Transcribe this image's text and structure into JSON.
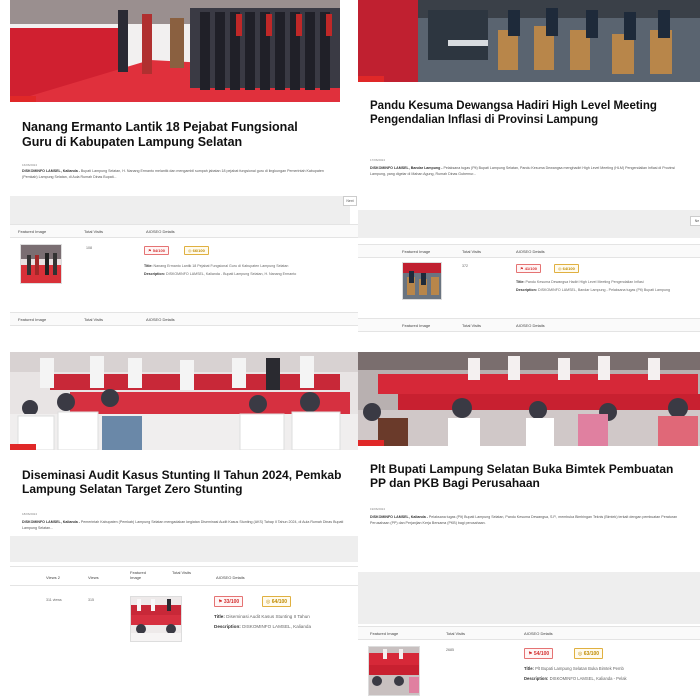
{
  "posts": [
    {
      "title": "Nanang Ermanto Lantik 18 Pejabat Fungsional Guru di Kabupaten Lampung Selatan",
      "meta": "16/06/2024",
      "excerpt_strong": "DISKOMINFO LAMSEL, Kalianda -",
      "excerpt": "Bupati Lampung Selatan, H. Nanang Ermanto melantik dan mengambil sumpah jabatan 18 pejabat fungsional guru di lingkungan Pemerintah Kabupaten (Pemkab) Lampung Selatan, di Aula Rumah Dinas Bupati...",
      "table_headers": [
        "Featured Image",
        "Total Visits",
        "AIOSEO Details"
      ],
      "visits": "108",
      "badge_red": "54/100",
      "badge_yellow": "66/100",
      "title_label": "Title:",
      "seo_title": "Nanang Ermanto Lantik 18 Pejabat Fungsional Guru di Kabupaten Lampung Selatan",
      "desc_label": "Description:",
      "seo_desc": "DISKOMINFO LAMSEL, Kalianda - Bupati Lampung Selatan, H. Nanang Ermanto",
      "edge_button": "Next",
      "next_headers": [
        "Featured Image",
        "Total Visits",
        "AIOSEO Details"
      ]
    },
    {
      "title": "Pandu Kesuma Dewangsa Hadiri High Level Meeting Pengendalian Inflasi di Provinsi Lampung",
      "meta": "17/06/2024",
      "excerpt_strong": "DISKOMINFO LAMSEL, Bandar Lampung -",
      "excerpt": "Pelaksana tugas (Plt) Bupati Lampung Selatan, Pandu Kesuma Dewangsa menghadiri High Level Meeting (HLM) Pengendalian Inflasi di Provinsi Lampung, yang digelar di Mahan Agung, Rumah Dinas Gubernur...",
      "table_headers": [
        "Featured Image",
        "Total Visits",
        "AIOSEO Details"
      ],
      "visits": "372",
      "badge_red": "41/100",
      "badge_yellow": "64/100",
      "title_label": "Title:",
      "seo_title": "Pandu Kesuma Dewangsa Hadiri High Level Meeting Pengendalian Inflasi",
      "desc_label": "Description:",
      "seo_desc": "DISKOMINFO LAMSEL, Bandar Lampung - Pelaksana tugas (Plt) Bupati Lampung",
      "edge_button": "Ne",
      "next_headers": [
        "Featured Image",
        "Total Visits",
        "AIOSEO Details"
      ]
    },
    {
      "title": "Diseminasi Audit Kasus Stunting II Tahun 2024, Pemkab Lampung Selatan Target Zero Stunting",
      "meta": "18/06/2024",
      "excerpt_strong": "DISKOMINFO LAMSEL, Kalianda -",
      "excerpt": "Pemerintah Kabupaten (Pemkab) Lampung Selatan mengadakan kegiatan Diseminasi Audit Kasus Stunting (AKS) Tahap II Tahun 2024, di Aula Rumah Dinas Bupati Lampung Selatan...",
      "table_headers": [
        "Views 2",
        "Views",
        "Featured Image",
        "Total Visits",
        "AIOSEO Details"
      ],
      "views2": "311 views",
      "views": "315",
      "badge_red": "33/100",
      "badge_yellow": "64/100",
      "title_label": "Title:",
      "seo_title": "Diseminasi Audit Kasus Stunting II Tahun",
      "desc_label": "Description:",
      "seo_desc": "DISKOMINFO LAMSEL, Kalianda"
    },
    {
      "title": "Plt Bupati Lampung Selatan Buka Bimtek Pembuatan PP dan PKB Bagi Perusahaan",
      "meta": "19/06/2024",
      "excerpt_strong": "DISKOMINFO LAMSEL, Kalianda -",
      "excerpt": "Pelaksana tugas (Plt) Bupati Lampung Selatan, Pandu Kesuma Dewangsa, S.P., membuka Bimbingan Teknis (Bimtek) terkait dengan pembuatan Peraturan Perusahaan (PP) dan Perjanjian Kerja Bersama (PKB) bagi perusahaan.",
      "table_headers": [
        "Featured Image",
        "Total Visits",
        "AIOSEO Details"
      ],
      "visits": "2685",
      "badge_red": "54/100",
      "badge_yellow": "63/100",
      "title_label": "Title:",
      "seo_title": "Plt Bupati Lampung Selatan Buka Bimtek Pemb",
      "desc_label": "Description:",
      "seo_desc": "DISKOMINFO LAMSEL, Kalianda - Pelak"
    }
  ],
  "colors": {
    "accent_red": "#e02828",
    "badge_red": "#d32f2f",
    "badge_yellow": "#c08a00"
  }
}
